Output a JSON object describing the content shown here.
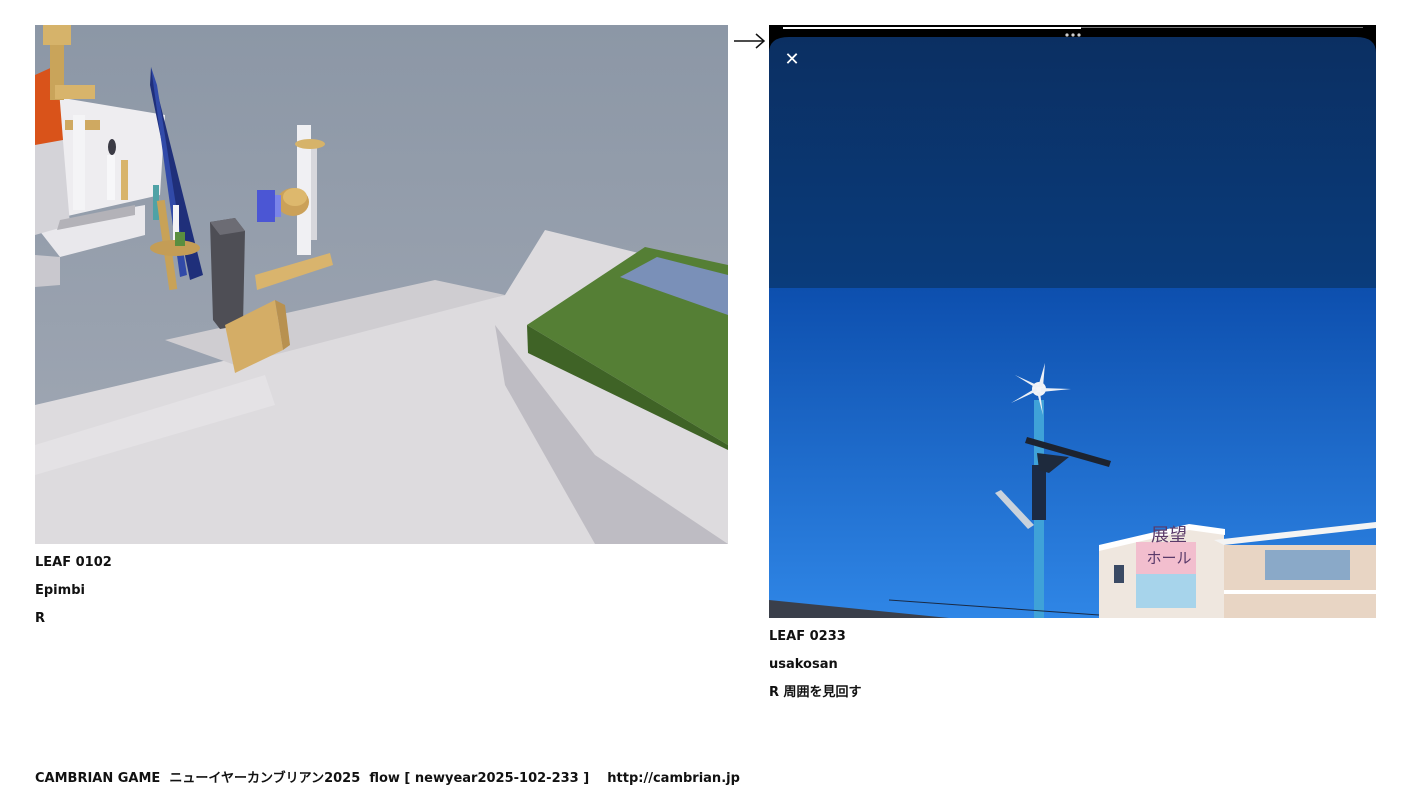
{
  "left_leaf": {
    "scene": "game-scene-image",
    "id_label": "LEAF 0102",
    "author": "Epimbi",
    "note": "R"
  },
  "right_leaf": {
    "scene": "photo-image",
    "id_label": "LEAF 0233",
    "author": "usakosan",
    "note": "R 周囲を見回す",
    "building_sign_line1": "展望",
    "building_sign_line2": "ホール",
    "close_glyph": "✕"
  },
  "link_arrow": "→",
  "footer": {
    "game_name": "CAMBRIAN GAME",
    "event": "ニューイヤーカンブリアン2025",
    "flow": "flow [ newyear2025-102-233 ]",
    "url": "http://cambrian.jp"
  },
  "colors": {
    "sky_dark": "#0a3a78",
    "sky_bright": "#1e6fd6",
    "grass": "#5d8a3c",
    "floor": "#dcdadd",
    "fog": "#98a3b3"
  }
}
